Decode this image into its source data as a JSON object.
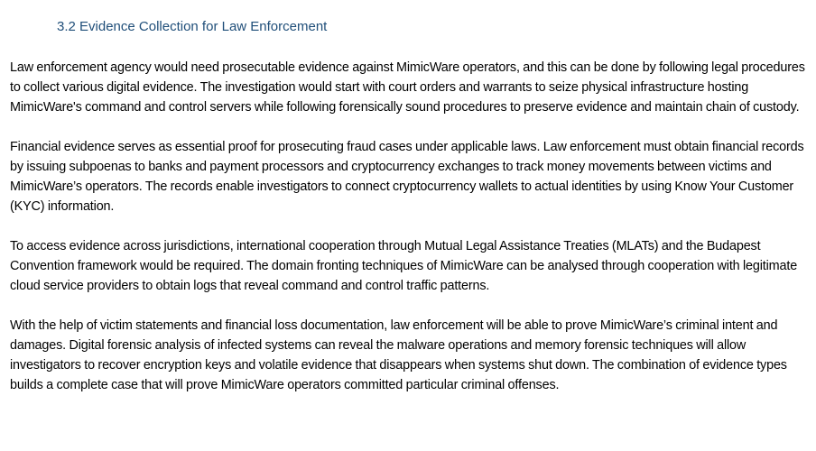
{
  "section": {
    "heading": "3.2 Evidence Collection for Law Enforcement"
  },
  "paragraphs": [
    "Law enforcement agency would need prosecutable evidence against MimicWare operators, and this can be done by following legal procedures to collect various digital evidence. The investigation would start with court orders and warrants to seize physical infrastructure hosting MimicWare's command and control servers while following forensically sound procedures to preserve evidence and maintain chain of custody.",
    "Financial evidence serves as essential proof for prosecuting fraud cases under applicable laws. Law enforcement must obtain financial records by issuing subpoenas to banks and payment processors and cryptocurrency exchanges to track money movements between victims and MimicWare’s operators. The records enable investigators to connect cryptocurrency wallets to actual identities by using Know Your Customer (KYC) information.",
    "To access evidence across jurisdictions, international cooperation through Mutual Legal Assistance Treaties  (MLATs) and the Budapest Convention framework would be required. The domain fronting techniques of MimicWare can be analysed through cooperation with legitimate cloud service providers to obtain logs that reveal command and control traffic patterns.",
    "With the help of victim statements and financial loss documentation, law enforcement will be able to prove MimicWare’s criminal intent and damages. Digital forensic analysis of infected systems can reveal the malware operations and memory forensic techniques will allow investigators to recover encryption keys and volatile evidence that disappears when systems shut down. The combination of evidence types builds a complete case that will prove MimicWare operators committed particular criminal offenses."
  ],
  "colors": {
    "heading": "#1f4e79",
    "text": "#000000",
    "background": "#ffffff"
  }
}
